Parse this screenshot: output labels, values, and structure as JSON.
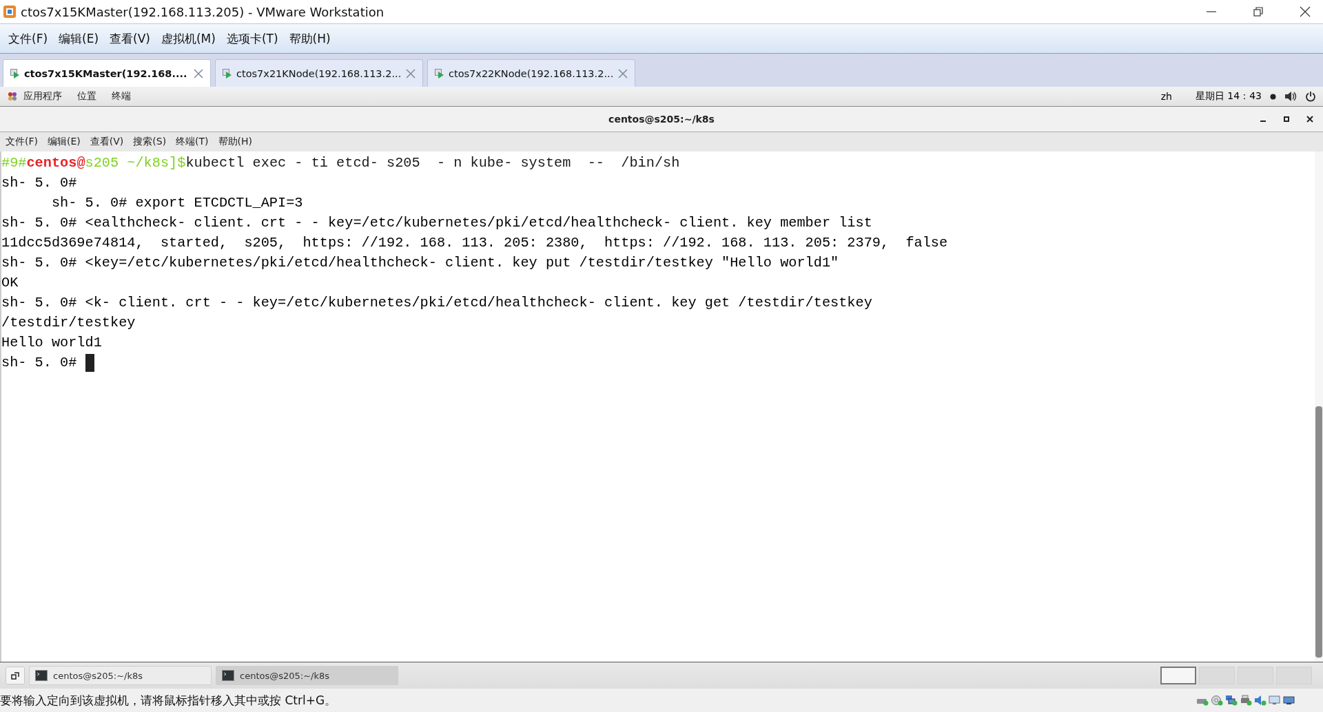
{
  "window": {
    "title": "ctos7x15KMaster(192.168.113.205) - VMware Workstation"
  },
  "menu": [
    "文件(F)",
    "编辑(E)",
    "查看(V)",
    "虚拟机(M)",
    "选项卡(T)",
    "帮助(H)"
  ],
  "vm_tabs": [
    {
      "label": "ctos7x15KMaster(192.168....",
      "selected": true
    },
    {
      "label": "ctos7x21KNode(192.168.113.2...",
      "selected": false
    },
    {
      "label": "ctos7x22KNode(192.168.113.2...",
      "selected": false
    }
  ],
  "guest_topbar": {
    "menu": [
      "应用程序",
      "位置",
      "终端"
    ],
    "language": "zh",
    "clock": "星期日 14：43"
  },
  "terminal": {
    "title": "centos@s205:~/k8s",
    "menu": [
      "文件(F)",
      "编辑(E)",
      "查看(V)",
      "搜索(S)",
      "终端(T)",
      "帮助(H)"
    ],
    "prompt_line": [
      {
        "text": "#9#",
        "color": "#7ed321"
      },
      {
        "text": "centos@",
        "color": "#e8262a"
      },
      {
        "text": "s205 ~/k8s]",
        "color": "#7ed321"
      },
      {
        "text": "$",
        "color": "#7ed321"
      },
      {
        "text": "kubectl exec - ti etcd- s205  - n kube- system  --  /bin/sh",
        "color": "#1a1a1a"
      }
    ],
    "lines": [
      "sh- 5. 0#",
      "      sh- 5. 0# export ETCDCTL_API=3",
      "sh- 5. 0# <ealthcheck- client. crt - - key=/etc/kubernetes/pki/etcd/healthcheck- client. key member list",
      "11dcc5d369e74814,  started,  s205,  https: //192. 168. 113. 205: 2380,  https: //192. 168. 113. 205: 2379,  false",
      "sh- 5. 0# <key=/etc/kubernetes/pki/etcd/healthcheck- client. key put /testdir/testkey \"Hello world1\"",
      "OK",
      "sh- 5. 0# <k- client. crt - - key=/etc/kubernetes/pki/etcd/healthcheck- client. key get /testdir/testkey",
      "/testdir/testkey",
      "Hello world1",
      "sh- 5. 0#"
    ],
    "cursor": true
  },
  "taskbar": {
    "items": [
      {
        "label": "centos@s205:~/k8s",
        "selected": false
      },
      {
        "label": "centos@s205:~/k8s",
        "selected": true
      }
    ],
    "workspaces": [
      {
        "selected": true
      },
      {
        "selected": false
      },
      {
        "selected": false
      },
      {
        "selected": false
      }
    ]
  },
  "status_bar": {
    "message": "要将输入定向到该虚拟机，请将鼠标指针移入其中或按 Ctrl+G。"
  }
}
